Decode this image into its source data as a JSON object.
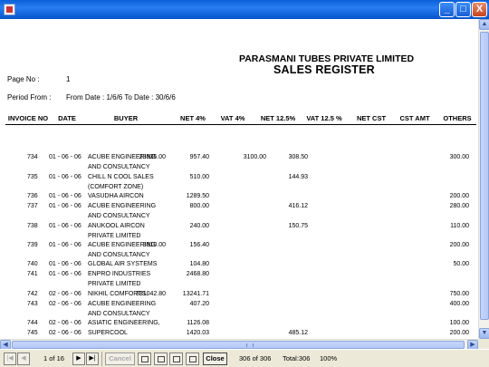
{
  "window": {
    "icon": "report-icon",
    "buttons": {
      "minimize": "_",
      "maximize": "□",
      "close": "X"
    }
  },
  "report": {
    "company": "PARASMANI TUBES PRIVATE LIMITED",
    "title": "SALES REGISTER",
    "page_no_label": "Page No :",
    "page_no_value": "1",
    "period_label": "Period From :",
    "period_value": "From Date : 1/6/6 To Date : 30/6/6",
    "columns": [
      "INVOICE NO",
      "DATE",
      "BUYER",
      "NET 4%",
      "VAT 4%",
      "NET 12.5%",
      "VAT 12.5 %",
      "NET CST",
      "CST AMT",
      "OTHERS"
    ],
    "rows": [
      {
        "invoice": "734",
        "date": "01 - 06 - 06",
        "buyer": [
          "ACUBE ENGINEERING",
          "AND CONSULTANCY"
        ],
        "net4": "23935.00",
        "vat4": "957.40",
        "net125": "3100.00",
        "vat125": "308.50",
        "others": "300.00"
      },
      {
        "invoice": "735",
        "date": "01 - 06 - 06",
        "buyer": [
          "CHILL N COOL SALES",
          "(COMFORT ZONE)"
        ],
        "net4": "",
        "vat4": "510.00",
        "net125": "",
        "vat125": "144.93",
        "others": ""
      },
      {
        "invoice": "736",
        "date": "01 - 06 - 06",
        "buyer": [
          "VASUDHA AIRCON"
        ],
        "net4": "",
        "vat4": "1289.50",
        "net125": "",
        "vat125": "",
        "others": "200.00"
      },
      {
        "invoice": "737",
        "date": "01 - 06 - 06",
        "buyer": [
          "ACUBE ENGINEERING",
          "AND CONSULTANCY"
        ],
        "net4": "",
        "vat4": "800.00",
        "net125": "",
        "vat125": "416.12",
        "others": "280.00"
      },
      {
        "invoice": "738",
        "date": "01 - 06 - 06",
        "buyer": [
          "ANUKOOL AIRCON",
          "PRIVATE LIMITED"
        ],
        "net4": "",
        "vat4": "240.00",
        "net125": "",
        "vat125": "150.75",
        "others": "110.00"
      },
      {
        "invoice": "739",
        "date": "01 - 06 - 06",
        "buyer": [
          "ACUBE ENGINEERING",
          "AND CONSULTANCY"
        ],
        "net4": "3910.00",
        "vat4": "156.40",
        "net125": "",
        "vat125": "",
        "others": "200.00"
      },
      {
        "invoice": "740",
        "date": "01 - 06 - 06",
        "buyer": [
          "GLOBAL AIR SYSTEMS"
        ],
        "net4": "",
        "vat4": "104.80",
        "net125": "",
        "vat125": "",
        "others": "50.00"
      },
      {
        "invoice": "741",
        "date": "01 - 06 - 06",
        "buyer": [
          "ENPRO INDUSTRIES",
          "PRIVATE LIMITED"
        ],
        "net4": "",
        "vat4": "2468.80",
        "net125": "",
        "vat125": "",
        "others": ""
      },
      {
        "invoice": "742",
        "date": "02 - 06 - 06",
        "buyer": [
          "NIKHIL COMFORTS."
        ],
        "net4": "331042.80",
        "vat4": "13241.71",
        "net125": "",
        "vat125": "",
        "others": "750.00"
      },
      {
        "invoice": "743",
        "date": "02 - 06 - 06",
        "buyer": [
          "ACUBE ENGINEERING",
          "AND CONSULTANCY"
        ],
        "net4": "",
        "vat4": "407.20",
        "net125": "",
        "vat125": "",
        "others": "400.00"
      },
      {
        "invoice": "744",
        "date": "02 - 06 - 06",
        "buyer": [
          "ASIATIC ENGINEERING,"
        ],
        "net4": "",
        "vat4": "1126.08",
        "net125": "",
        "vat125": "",
        "others": "100.00"
      },
      {
        "invoice": "745",
        "date": "02 - 06 - 06",
        "buyer": [
          "SUPERCOOL",
          "ENGINEERING",
          "SERVICES."
        ],
        "net4": "",
        "vat4": "1420.03",
        "net125": "",
        "vat125": "485.12",
        "others": "200.00"
      }
    ]
  },
  "toolbar": {
    "page_indicator": "1 of 16",
    "cancel_label": "Cancel",
    "close_label": "Close",
    "record_count": "306 of 306",
    "total_label": "Total:306",
    "zoom": "100%"
  }
}
